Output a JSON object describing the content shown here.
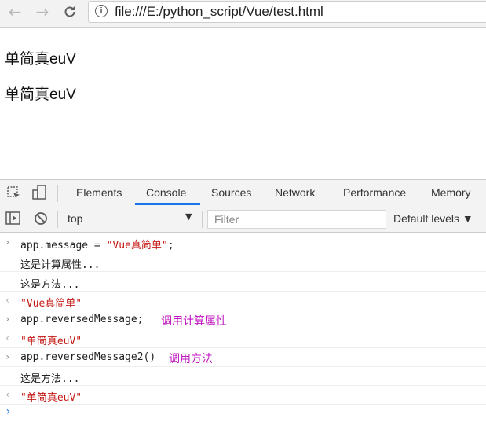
{
  "browser": {
    "url": "file:///E:/python_script/Vue/test.html"
  },
  "page": {
    "line1": "单简真euV",
    "line2": "单简真euV"
  },
  "devtools": {
    "tabs": [
      "Elements",
      "Console",
      "Sources",
      "Network",
      "Performance",
      "Memory"
    ],
    "active_tab": "Console",
    "context": "top",
    "filter_placeholder": "Filter",
    "levels": "Default levels ▼"
  },
  "console": {
    "rows": [
      {
        "type": "input",
        "code": "app.message = ",
        "str": "\"Vue真简单\"",
        "tail": ";",
        "note": ""
      },
      {
        "type": "log",
        "text": "这是计算属性..."
      },
      {
        "type": "log",
        "text": "这是方法..."
      },
      {
        "type": "result",
        "str": "\"Vue真简单\""
      },
      {
        "type": "input",
        "code": "app.reversedMessage;",
        "str": "",
        "tail": "",
        "note": "调用计算属性"
      },
      {
        "type": "result",
        "str": "\"单简真euV\""
      },
      {
        "type": "input",
        "code": "app.reversedMessage2()",
        "str": "",
        "tail": "",
        "note": "调用方法"
      },
      {
        "type": "log",
        "text": "这是方法..."
      },
      {
        "type": "result",
        "str": "\"单简真euV\""
      }
    ]
  },
  "colors": {
    "accent": "#1a73e8",
    "string": "#c41a16",
    "annotation": "#c016c0"
  }
}
